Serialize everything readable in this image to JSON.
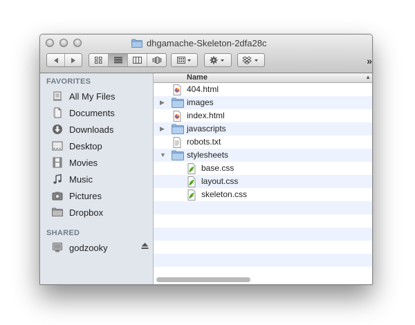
{
  "window": {
    "title": "dhgamache-Skeleton-2dfa28c"
  },
  "toolbar": {
    "overflow": "»"
  },
  "sidebar": {
    "favorites_title": "FAVORITES",
    "favorites": [
      {
        "label": "All My Files",
        "icon": "all-files-icon"
      },
      {
        "label": "Documents",
        "icon": "documents-icon"
      },
      {
        "label": "Downloads",
        "icon": "downloads-icon"
      },
      {
        "label": "Desktop",
        "icon": "desktop-icon"
      },
      {
        "label": "Movies",
        "icon": "movies-icon"
      },
      {
        "label": "Music",
        "icon": "music-icon"
      },
      {
        "label": "Pictures",
        "icon": "camera-icon"
      },
      {
        "label": "Dropbox",
        "icon": "folder-icon"
      }
    ],
    "shared_title": "SHARED",
    "shared": [
      {
        "label": "godzooky",
        "icon": "computer-icon"
      }
    ]
  },
  "file_list": {
    "column_name": "Name",
    "items": [
      {
        "name": "404.html",
        "type": "html",
        "level": 0,
        "disclosure": "none"
      },
      {
        "name": "images",
        "type": "folder",
        "level": 0,
        "disclosure": "collapsed"
      },
      {
        "name": "index.html",
        "type": "html",
        "level": 0,
        "disclosure": "none"
      },
      {
        "name": "javascripts",
        "type": "folder",
        "level": 0,
        "disclosure": "collapsed"
      },
      {
        "name": "robots.txt",
        "type": "text",
        "level": 0,
        "disclosure": "none"
      },
      {
        "name": "stylesheets",
        "type": "folder",
        "level": 0,
        "disclosure": "expanded"
      },
      {
        "name": "base.css",
        "type": "css",
        "level": 1,
        "disclosure": "none"
      },
      {
        "name": "layout.css",
        "type": "css",
        "level": 1,
        "disclosure": "none"
      },
      {
        "name": "skeleton.css",
        "type": "css",
        "level": 1,
        "disclosure": "none"
      }
    ]
  },
  "colors": {
    "sidebar_bg": "#e1e6ed",
    "alt_row": "#edf3fe",
    "folder": "#8fb5de"
  }
}
